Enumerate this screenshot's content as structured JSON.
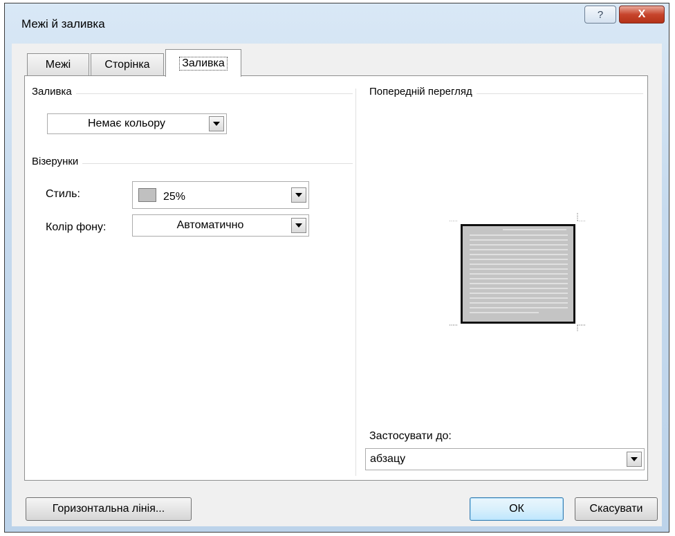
{
  "window": {
    "title": "Межі й заливка",
    "help_label": "?",
    "close_label": "X"
  },
  "tabs": [
    {
      "label": "Межі"
    },
    {
      "label": "Сторінка"
    },
    {
      "label": "Заливка",
      "active": true
    }
  ],
  "fill": {
    "group_label": "Заливка",
    "color_value": "Немає кольору"
  },
  "patterns": {
    "group_label": "Візерунки",
    "style_label": "Стиль:",
    "style_value": "25%",
    "background_label": "Колір фону:",
    "background_value": "Автоматично"
  },
  "preview": {
    "group_label": "Попередній перегляд",
    "apply_label": "Застосувати до:",
    "apply_value": "абзацу"
  },
  "buttons": {
    "horizontal_line": "Горизонтальна лінія...",
    "ok": "ОК",
    "cancel": "Скасувати"
  },
  "colors": {
    "swatch": "#c0c0c0",
    "preview_fill": "#c4c4c4",
    "close_red": "#c7442c"
  },
  "icons": [
    "help-icon",
    "close-icon",
    "chevron-down-icon"
  ]
}
